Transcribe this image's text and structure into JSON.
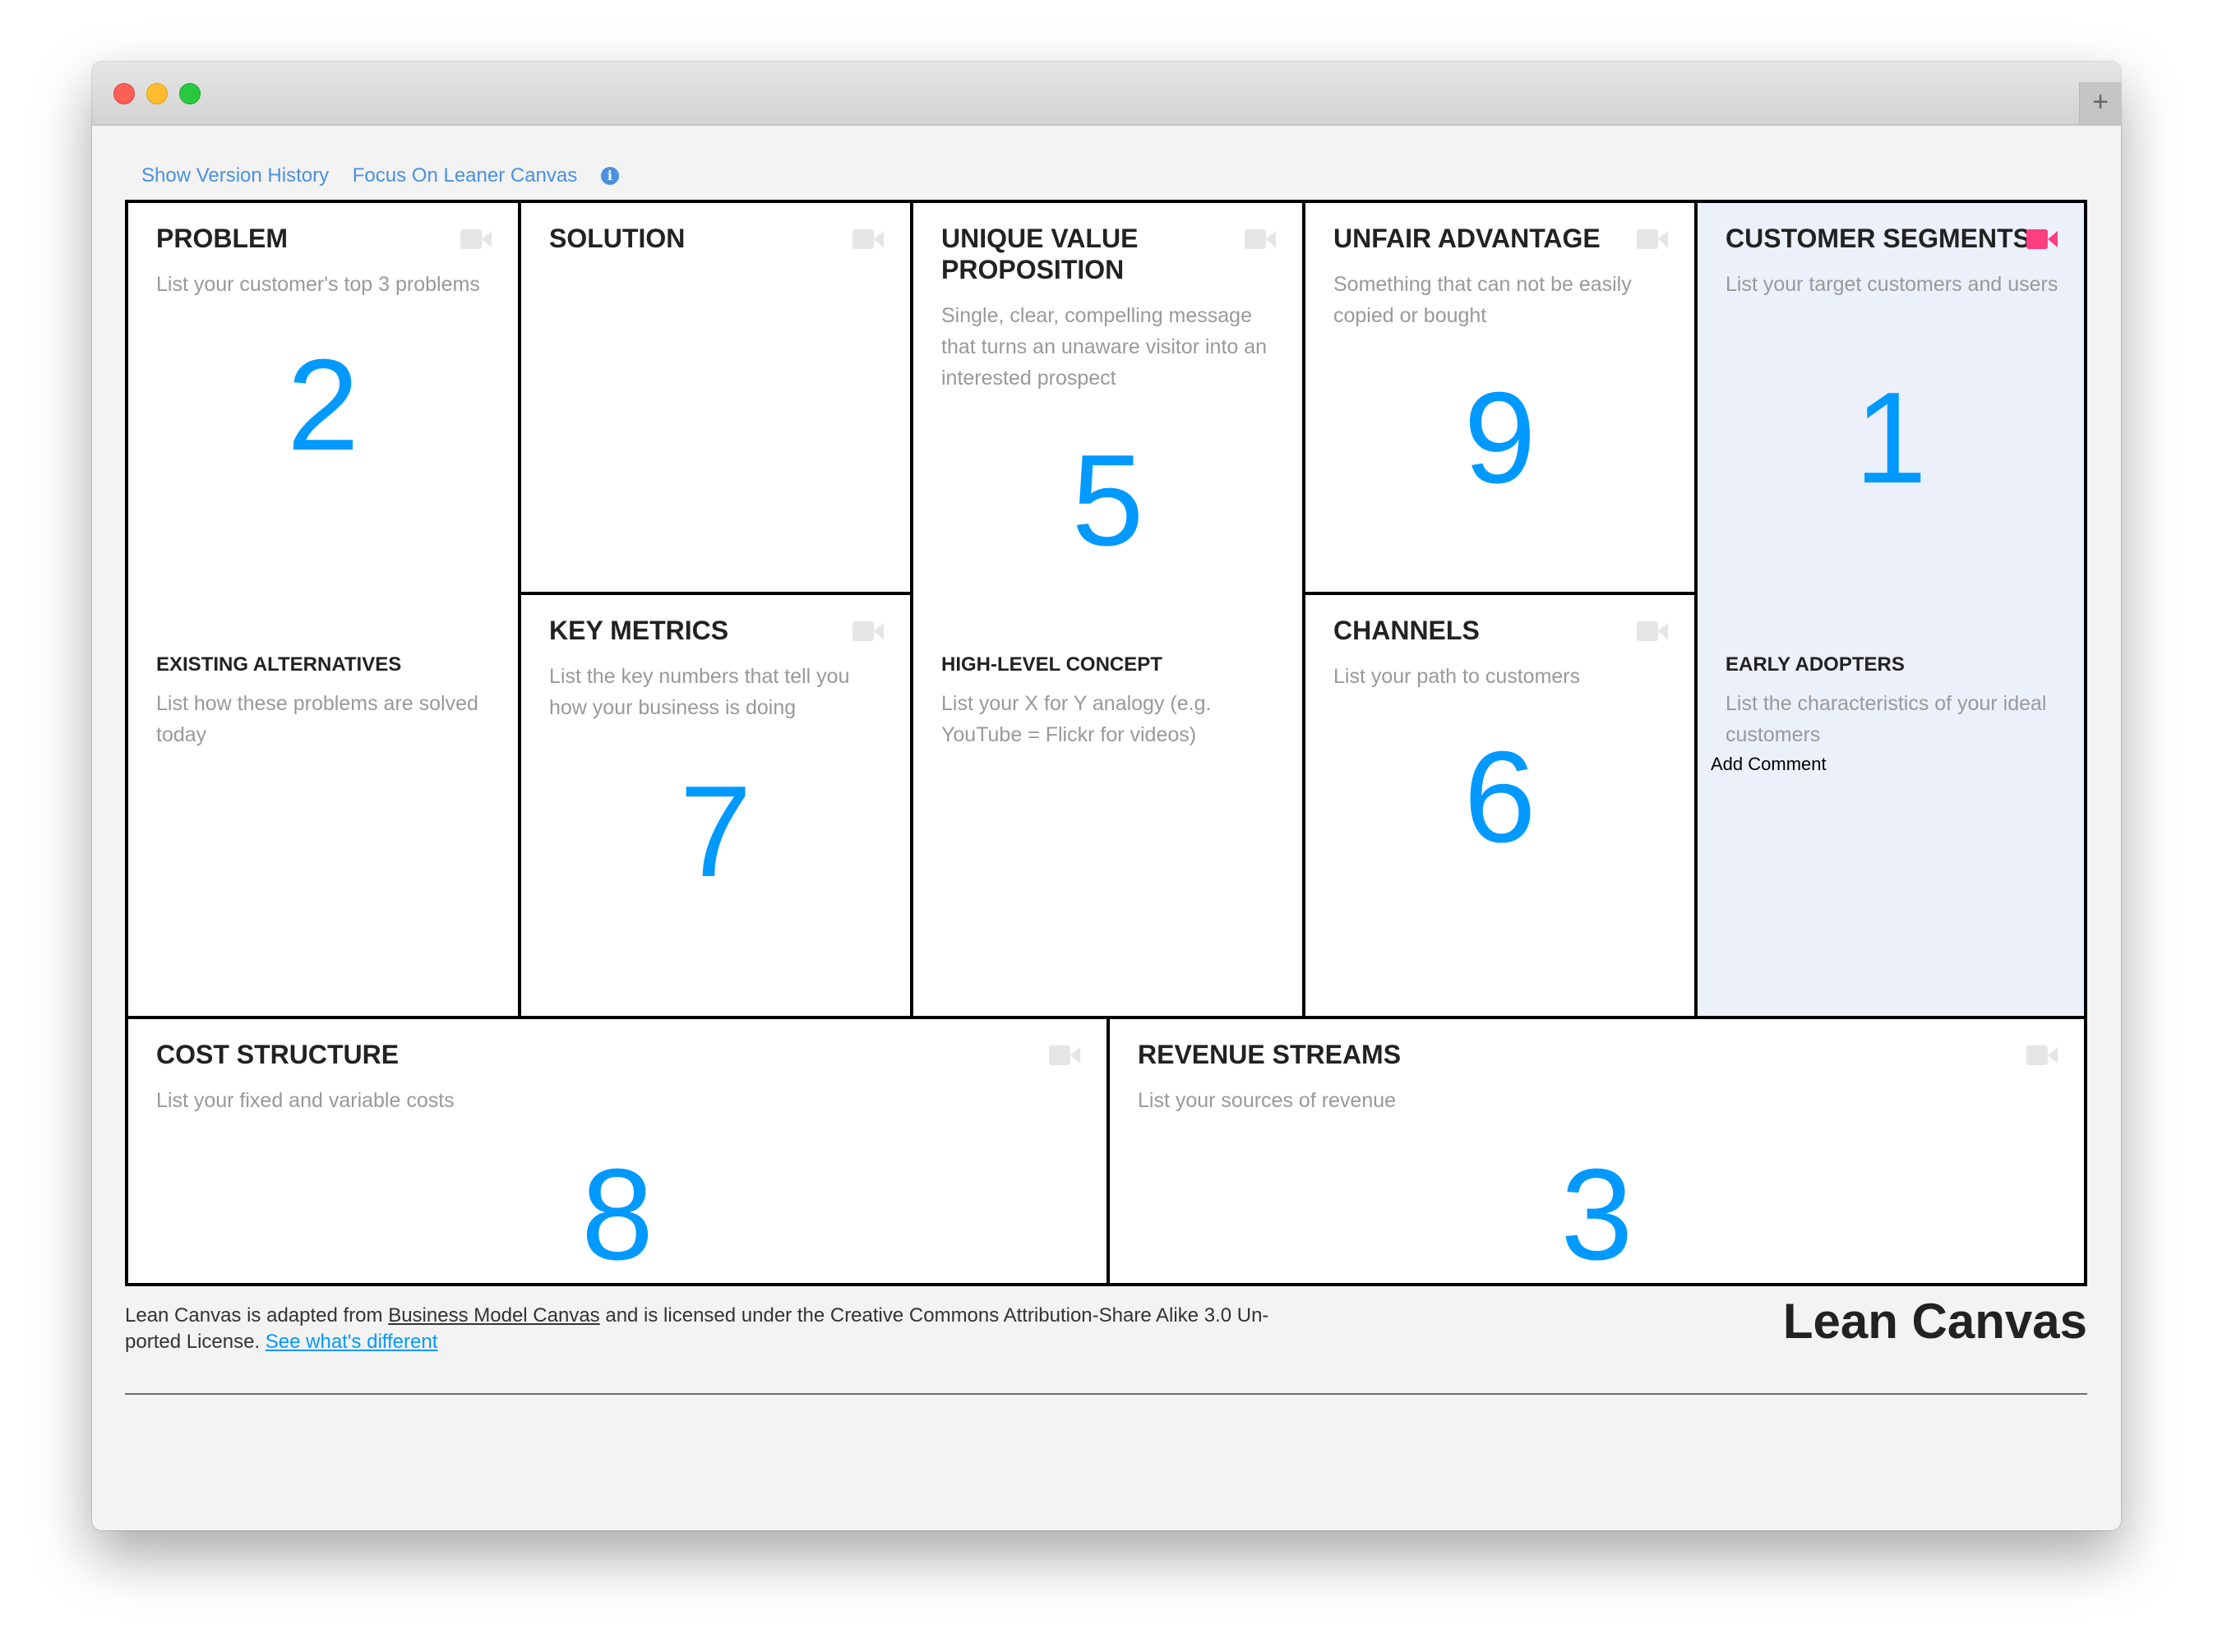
{
  "window": {
    "new_tab_label": "+"
  },
  "toolbar": {
    "version_history": "Show Version History",
    "focus": "Focus On Leaner Canvas",
    "info_glyph": "i"
  },
  "canvas": {
    "problem": {
      "title": "PROBLEM",
      "desc": "List your customer's top 3 problems",
      "number": "2",
      "sub_title": "EXISTING ALTERNATIVES",
      "sub_desc": "List how these problems are solved today"
    },
    "solution": {
      "title": "SOLUTION"
    },
    "key_metrics": {
      "title": "KEY METRICS",
      "desc": "List the key numbers that tell you how your business is doing",
      "number": "7"
    },
    "uvp": {
      "title": "UNIQUE VALUE PROPOSITION",
      "desc": "Single, clear, compelling message that turns an unaware visitor into an interested prospect",
      "number": "5",
      "sub_title": "HIGH-LEVEL CONCEPT",
      "sub_desc": "List your X for Y analogy (e.g. YouTube = Flickr for videos)"
    },
    "unfair_advantage": {
      "title": "UNFAIR ADVANTAGE",
      "desc": "Something that can not be easily copied or bought",
      "number": "9"
    },
    "channels": {
      "title": "CHANNELS",
      "desc": "List your path to customers",
      "number": "6"
    },
    "customer_segments": {
      "title": "CUSTOMER SEGMENTS",
      "desc": "List your target customers and users",
      "number": "1",
      "sub_title": "EARLY ADOPTERS",
      "sub_desc": "List the characteristics of your ideal customers",
      "add_comment": "Add Comment"
    },
    "cost_structure": {
      "title": "COST STRUCTURE",
      "desc": "List your fixed and variable costs",
      "number": "8"
    },
    "revenue_streams": {
      "title": "REVENUE STREAMS",
      "desc": "List your sources of revenue",
      "number": "3"
    }
  },
  "footer": {
    "text_1": "Lean Canvas is adapted from ",
    "bmc_link": "Business Model Canvas",
    "text_2": " and is licensed under the Creative Commons Attribution-Share Alike 3.0 Un-ported License. ",
    "diff_link": "See what's different",
    "brand": "Lean Canvas"
  },
  "colors": {
    "accent_blue": "#0099ff",
    "link_blue": "#4a90e2",
    "video_active": "#ff3e7f",
    "highlight_bg": "#ebf0fa"
  }
}
